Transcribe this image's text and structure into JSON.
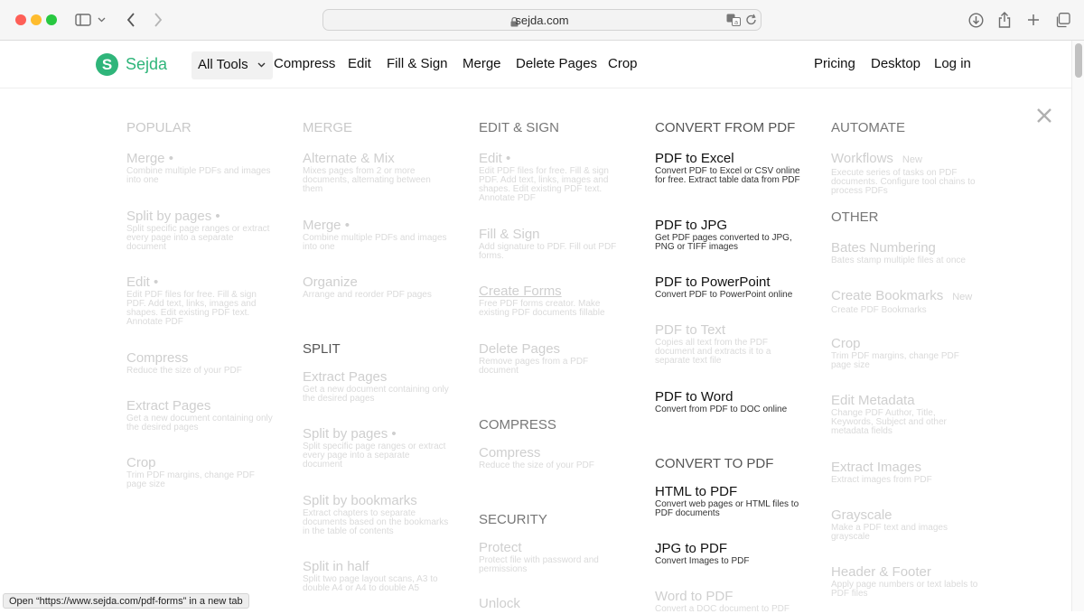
{
  "browser": {
    "domain": "sejda.com"
  },
  "nav": {
    "logo": "Sejda",
    "all_tools": "All Tools",
    "links": [
      "Compress",
      "Edit",
      "Fill & Sign",
      "Merge",
      "Delete Pages",
      "Crop"
    ],
    "right_links": [
      "Pricing",
      "Desktop",
      "Log in"
    ]
  },
  "menu": {
    "popular": {
      "title": "POPULAR",
      "items": [
        {
          "title": "Merge",
          "desc": "Combine multiple PDFs and images into one"
        },
        {
          "title": "Split by pages",
          "desc": "Split specific page ranges or extract every page into a separate document"
        },
        {
          "title": "Edit",
          "desc": "Edit PDF files for free. Fill & sign PDF. Add text, links, images and shapes. Edit existing PDF text. Annotate PDF"
        },
        {
          "title": "Compress",
          "desc": "Reduce the size of your PDF"
        },
        {
          "title": "Extract Pages",
          "desc": "Get a new document containing only the desired pages"
        },
        {
          "title": "Crop",
          "desc": "Trim PDF margins, change PDF page size"
        }
      ]
    },
    "merge": {
      "title": "MERGE",
      "items": [
        {
          "title": "Alternate & Mix",
          "desc": "Mixes pages from 2 or more documents, alternating between them"
        },
        {
          "title": "Merge",
          "desc": "Combine multiple PDFs and images into one"
        },
        {
          "title": "Organize",
          "desc": "Arrange and reorder PDF pages"
        }
      ]
    },
    "split": {
      "title": "SPLIT",
      "items": [
        {
          "title": "Extract Pages",
          "desc": "Get a new document containing only the desired pages"
        },
        {
          "title": "Split by pages",
          "desc": "Split specific page ranges or extract every page into a separate document"
        },
        {
          "title": "Split by bookmarks",
          "desc": "Extract chapters to separate documents based on the bookmarks in the table of contents"
        },
        {
          "title": "Split in half",
          "desc": "Split two page layout scans, A3 to double A4 or A4 to double A5"
        }
      ]
    },
    "edit_sign": {
      "title": "EDIT & SIGN",
      "items": [
        {
          "title": "Edit",
          "desc": "Edit PDF files for free. Fill & sign PDF. Add text, links, images and shapes. Edit existing PDF text. Annotate PDF"
        },
        {
          "title": "Fill & Sign",
          "desc": "Add signature to PDF. Fill out PDF forms."
        },
        {
          "title": "Create Forms",
          "desc": "Free PDF forms creator. Make existing PDF documents fillable"
        },
        {
          "title": "Delete Pages",
          "desc": "Remove pages from a PDF document"
        }
      ]
    },
    "compress": {
      "title": "COMPRESS",
      "items": [
        {
          "title": "Compress",
          "desc": "Reduce the size of your PDF"
        }
      ]
    },
    "security": {
      "title": "SECURITY",
      "items": [
        {
          "title": "Protect",
          "desc": "Protect file with password and permissions"
        },
        {
          "title": "Unlock",
          "desc": ""
        }
      ]
    },
    "convert_from": {
      "title": "CONVERT FROM PDF",
      "items": [
        {
          "title": "PDF to Excel",
          "desc": "Convert PDF to Excel or CSV online for free. Extract table data from PDF"
        },
        {
          "title": "PDF to JPG",
          "desc": "Get PDF pages converted to JPG, PNG or TIFF images"
        },
        {
          "title": "PDF to PowerPoint",
          "desc": "Convert PDF to PowerPoint online"
        },
        {
          "title": "PDF to Text",
          "desc": "Copies all text from the PDF document and extracts it to a separate text file"
        },
        {
          "title": "PDF to Word",
          "desc": "Convert from PDF to DOC online"
        }
      ]
    },
    "convert_to": {
      "title": "CONVERT TO PDF",
      "items": [
        {
          "title": "HTML to PDF",
          "desc": "Convert web pages or HTML files to PDF documents"
        },
        {
          "title": "JPG to PDF",
          "desc": "Convert Images to PDF"
        },
        {
          "title": "Word to PDF",
          "desc": "Convert a DOC document to PDF"
        }
      ]
    },
    "automate": {
      "title": "AUTOMATE",
      "items": [
        {
          "title": "Workflows",
          "badge": "New",
          "desc": "Execute series of tasks on PDF documents. Configure tool chains to process PDFs"
        }
      ]
    },
    "other": {
      "title": "OTHER",
      "items": [
        {
          "title": "Bates Numbering",
          "desc": "Bates stamp multiple files at once"
        },
        {
          "title": "Create Bookmarks",
          "badge": "New",
          "desc": "Create PDF Bookmarks"
        },
        {
          "title": "Crop",
          "desc": "Trim PDF margins, change PDF page size"
        },
        {
          "title": "Edit Metadata",
          "desc": "Change PDF Author, Title, Keywords, Subject and other metadata fields"
        },
        {
          "title": "Extract Images",
          "desc": "Extract images from PDF"
        },
        {
          "title": "Grayscale",
          "desc": "Make a PDF text and images grayscale"
        },
        {
          "title": "Header & Footer",
          "desc": "Apply page numbers or text labels to PDF files"
        }
      ]
    }
  },
  "status_bar": "Open “https://www.sejda.com/pdf-forms” in a new tab"
}
